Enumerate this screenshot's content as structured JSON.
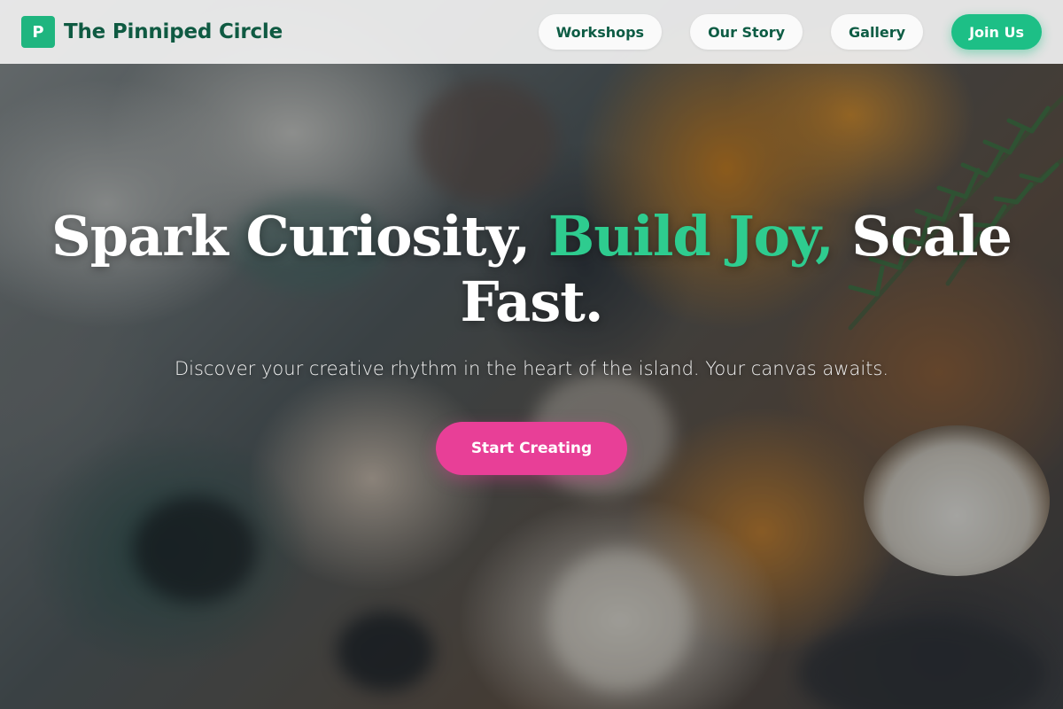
{
  "header": {
    "logo_letter": "P",
    "brand_name": "The Pinniped Circle",
    "nav": [
      {
        "label": "Workshops"
      },
      {
        "label": "Our Story"
      },
      {
        "label": "Gallery"
      }
    ],
    "cta_label": "Join Us"
  },
  "hero": {
    "title_part1": "Spark Curiosity, ",
    "title_accent": "Build Joy,",
    "title_part2": " Scale Fast.",
    "subtitle": "Discover your creative rhythm in the heart of the island. Your canvas awaits.",
    "cta_label": "Start Creating"
  },
  "colors": {
    "brand_green": "#1dbf86",
    "title_accent_green": "#2ecc8f",
    "cta_pink": "#e83f97",
    "brand_text": "#0f5a42"
  }
}
